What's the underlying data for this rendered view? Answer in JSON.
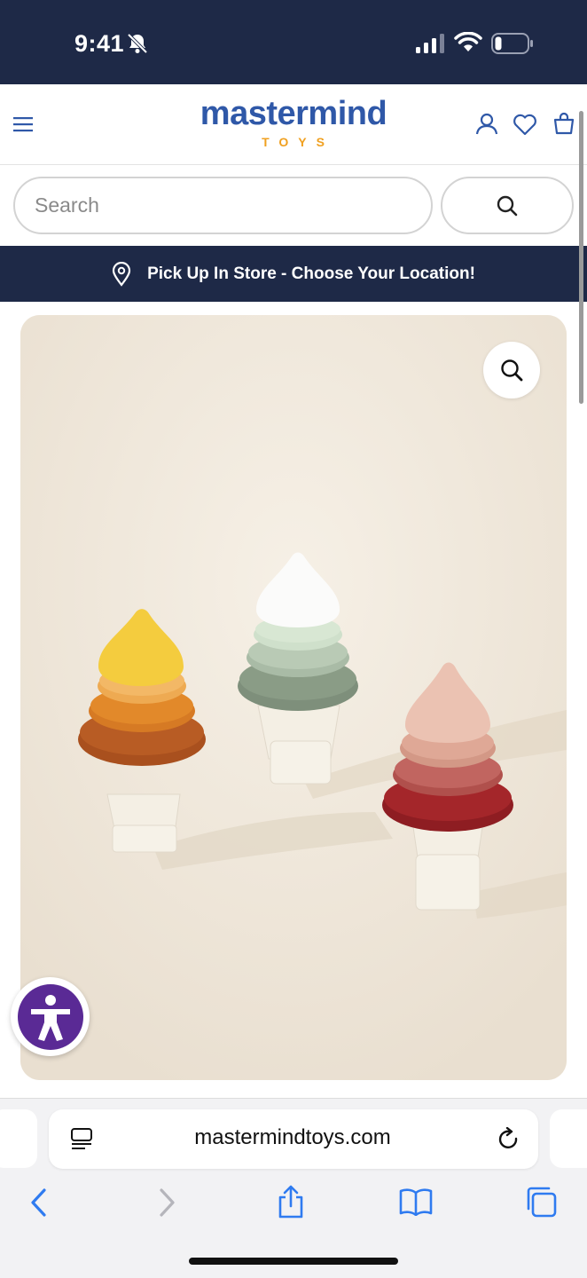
{
  "status_bar": {
    "time": "9:41"
  },
  "header": {
    "logo": {
      "main": "mastermind",
      "sub": "TOYS"
    }
  },
  "search": {
    "placeholder": "Search"
  },
  "pickup_banner": {
    "text": "Pick Up In Store - Choose Your Location!"
  },
  "browser": {
    "url": "mastermindtoys.com"
  },
  "colors": {
    "navy": "#1e2947",
    "logo_blue": "#2f58a8",
    "logo_orange": "#f0a020",
    "accessibility_purple": "#5a2a95"
  },
  "icons": [
    "menu-icon",
    "user-icon",
    "heart-icon",
    "bag-icon",
    "search-icon",
    "location-pin-icon",
    "zoom-icon",
    "accessibility-icon",
    "reader-icon",
    "reload-icon",
    "back-icon",
    "forward-icon",
    "share-icon",
    "bookmarks-icon",
    "tabs-icon"
  ]
}
